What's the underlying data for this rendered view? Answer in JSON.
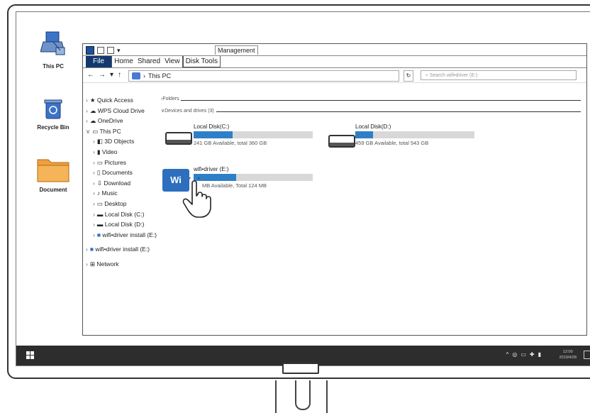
{
  "desktop": {
    "icons": [
      {
        "label": "This PC"
      },
      {
        "label": "Recycle Bin"
      },
      {
        "label": "Document"
      }
    ]
  },
  "explorer": {
    "context_tab": "Management",
    "ribbon_tabs": [
      "File",
      "Home",
      "Shared",
      "View",
      "Disk Tools"
    ],
    "address": "This PC",
    "search_placeholder": "Search wifi•driver (E:)",
    "nav": [
      {
        "label": "Quick Access",
        "icon": "star-icon"
      },
      {
        "label": "WPS Cloud Drive",
        "icon": "cloud-icon"
      },
      {
        "label": "OneDrive",
        "icon": "cloud-icon"
      },
      {
        "label": "This PC",
        "icon": "computer-icon"
      },
      {
        "label": "3D Objects",
        "icon": "cube-icon"
      },
      {
        "label": "Video",
        "icon": "video-icon"
      },
      {
        "label": "Pictures",
        "icon": "picture-icon"
      },
      {
        "label": "Documents",
        "icon": "document-icon"
      },
      {
        "label": "Download",
        "icon": "download-icon"
      },
      {
        "label": "Music",
        "icon": "music-icon"
      },
      {
        "label": "Desktop",
        "icon": "desktop-icon"
      },
      {
        "label": "Local Disk (C:)",
        "icon": "drive-icon"
      },
      {
        "label": "Local Disk (D:)",
        "icon": "drive-icon"
      },
      {
        "label": "wifi•driver install (E:)",
        "icon": "wifi-drive-icon"
      },
      {
        "label": "wifi•driver install (E:)",
        "icon": "wifi-drive-icon"
      },
      {
        "label": "Network",
        "icon": "network-icon"
      }
    ],
    "groups": {
      "folders": "›Folders",
      "devices": "∨Devices and drives (3)"
    },
    "drives": [
      {
        "name": "Local Disk(C:)",
        "info": "241 GB Available, total 360 GB",
        "used": 0.33
      },
      {
        "name": "Local Disk(D:)",
        "info": "459 GB Available, total 543 GB",
        "used": 0.15
      },
      {
        "name": "wifi•driver (E:)",
        "info": "MB Available, Total 124 MB",
        "used": 0.36
      }
    ]
  },
  "taskbar": {
    "tray": [
      "^",
      "◎",
      "▭",
      "✚",
      "▮"
    ],
    "time": "12:00",
    "date": "2019/4/28"
  }
}
